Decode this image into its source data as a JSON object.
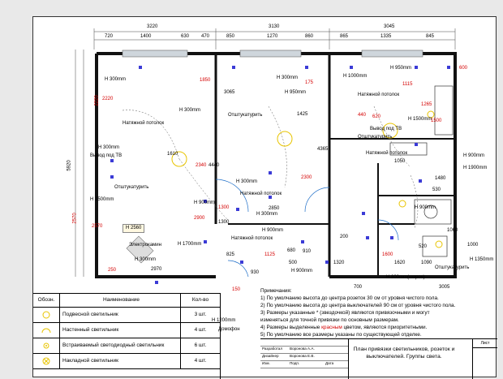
{
  "plan": {
    "top_dims": {
      "overall": [
        "3220",
        "3130",
        "3045"
      ],
      "segments": [
        "720",
        "1400",
        "630",
        "470",
        "850",
        "1270",
        "860",
        "865",
        "1335",
        "845"
      ]
    },
    "left_dims": [
      "5920",
      "2220",
      "2570"
    ],
    "room_labels": {
      "ceiling_1": "Натяжной потолок",
      "ceiling_2": "Натяжной потолок",
      "ceiling_3": "Натяжной потолок",
      "ceiling_4": "Натяжной потолок",
      "ceiling_5": "Натяжной потолок",
      "plaster_1": "Отштукатурить",
      "plaster_2": "Отштукатурить",
      "plaster_3": "Отштукатурить",
      "plaster_4": "Отштукатурить",
      "tv_1": "Вывод под ТВ",
      "tv_2": "Вывод под ТВ",
      "convector": "Электрокамин",
      "domofon": "Домофон",
      "room_height": "H 2560"
    },
    "heights": [
      "H 300mm",
      "H 300mm",
      "H 300mm",
      "H 300mm",
      "H 300mm",
      "H 300mm",
      "H 950mm",
      "H 1000mm",
      "H 950mm",
      "H 1500mm",
      "H 900mm",
      "H 1900mm",
      "H 900mm",
      "H 1500mm",
      "H 1700mm",
      "H 1200mm",
      "H 1350mm",
      "H 900mm",
      "H 900mm",
      "H 300mm",
      "H 800mm(шарок)",
      "H 900mm"
    ],
    "red_dims": [
      "2220",
      "2570",
      "1850",
      "2340",
      "2900",
      "1300",
      "2300",
      "1425",
      "2850",
      "1115",
      "620",
      "1265",
      "600",
      "1125",
      "1600",
      "250",
      "175",
      "440",
      "1500"
    ],
    "inner_dims": [
      "3065",
      "4440",
      "4365",
      "1610",
      "2970",
      "530",
      "1050",
      "1480",
      "1620",
      "1000",
      "1300",
      "1060",
      "1090",
      "520",
      "1320",
      "3005",
      "200",
      "680",
      "930",
      "825",
      "700",
      "910",
      "500",
      "150"
    ]
  },
  "legend": {
    "headers": {
      "symbol": "Обозн.",
      "name": "Наименование",
      "qty": "Кол-во"
    },
    "rows": [
      {
        "name": "Подвесной светильник",
        "qty": "3 шт."
      },
      {
        "name": "Настенный светильник",
        "qty": "4 шт."
      },
      {
        "name": "Встраиваемый светодиодный светильник",
        "qty": "6 шт."
      },
      {
        "name": "Накладной светильник",
        "qty": "4 шт."
      }
    ]
  },
  "notes": {
    "title": "Примечания:",
    "items": [
      "1) По умолчанию высота до центра розеток 30 см от уровня чистого пола.",
      "2) По умолчанию высота до центра выключателей 90 см от уровня чистого пола.",
      "3) Размеры указанные * (звездочкой) являются привязочными и могут",
      "изменяться для точной привязки по основным размерам.",
      "4) Размеры выделенные красным цветом, являются приоритетными.",
      "5) По умолчанию все размеры указаны по существующей отделке."
    ],
    "red_word": "красным"
  },
  "stamp": {
    "rows": [
      {
        "role": "Разработал",
        "name": "Воронова А.А.",
        "sign": "",
        "date": ""
      },
      {
        "role": "Дизайнер",
        "name": "Воронова Е.В.",
        "sign": "",
        "date": ""
      },
      {
        "role": "Изм.",
        "name": "Подп.",
        "sign": "",
        "date": "Дата"
      }
    ],
    "title": "План привязки светильников, розеток и выключателей. Группы света.",
    "sheet_label": "Лист"
  },
  "colors": {
    "wall": "#111111",
    "dim_red": "#d40000",
    "socket_blue": "#3b3bd6",
    "door_blue": "#1e6ec8",
    "lamp_yellow": "#e8c400",
    "window_gray": "#cfd6dc"
  }
}
